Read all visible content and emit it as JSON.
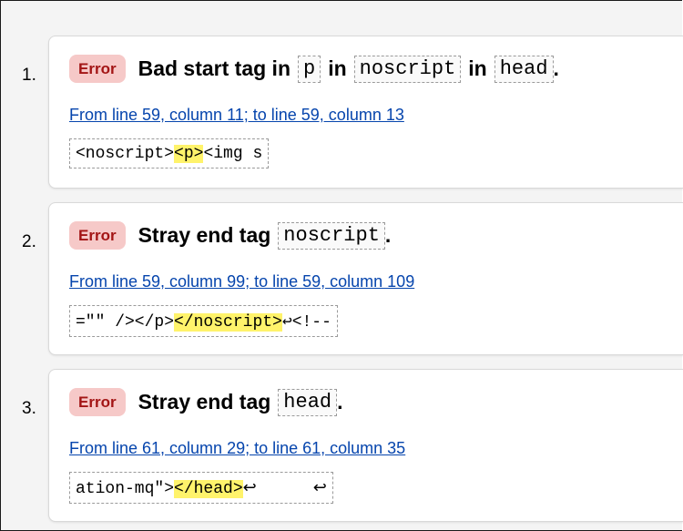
{
  "messages": [
    {
      "number": "1.",
      "type": "Error",
      "parts": [
        "Bad start tag in",
        "p",
        "in",
        "noscript",
        "in",
        "head",
        "."
      ],
      "location": "From line 59, column 11; to line 59, column 13",
      "extract": {
        "before": "<noscript>",
        "highlight": "<p>",
        "after": "<img s",
        "tail": ""
      }
    },
    {
      "number": "2.",
      "type": "Error",
      "parts": [
        "Stray end tag",
        "noscript",
        "."
      ],
      "location": "From line 59, column 99; to line 59, column 109",
      "extract": {
        "before": "=\"\" /></p>",
        "highlight": "</noscript>",
        "after": "↩<!--",
        "tail": ""
      }
    },
    {
      "number": "3.",
      "type": "Error",
      "parts": [
        "Stray end tag",
        "head",
        "."
      ],
      "location": "From line 61, column 29; to line 61, column 35",
      "extract": {
        "before": "ation-mq\">",
        "highlight": "</head>",
        "after": "↩",
        "tail": "↩"
      }
    }
  ]
}
